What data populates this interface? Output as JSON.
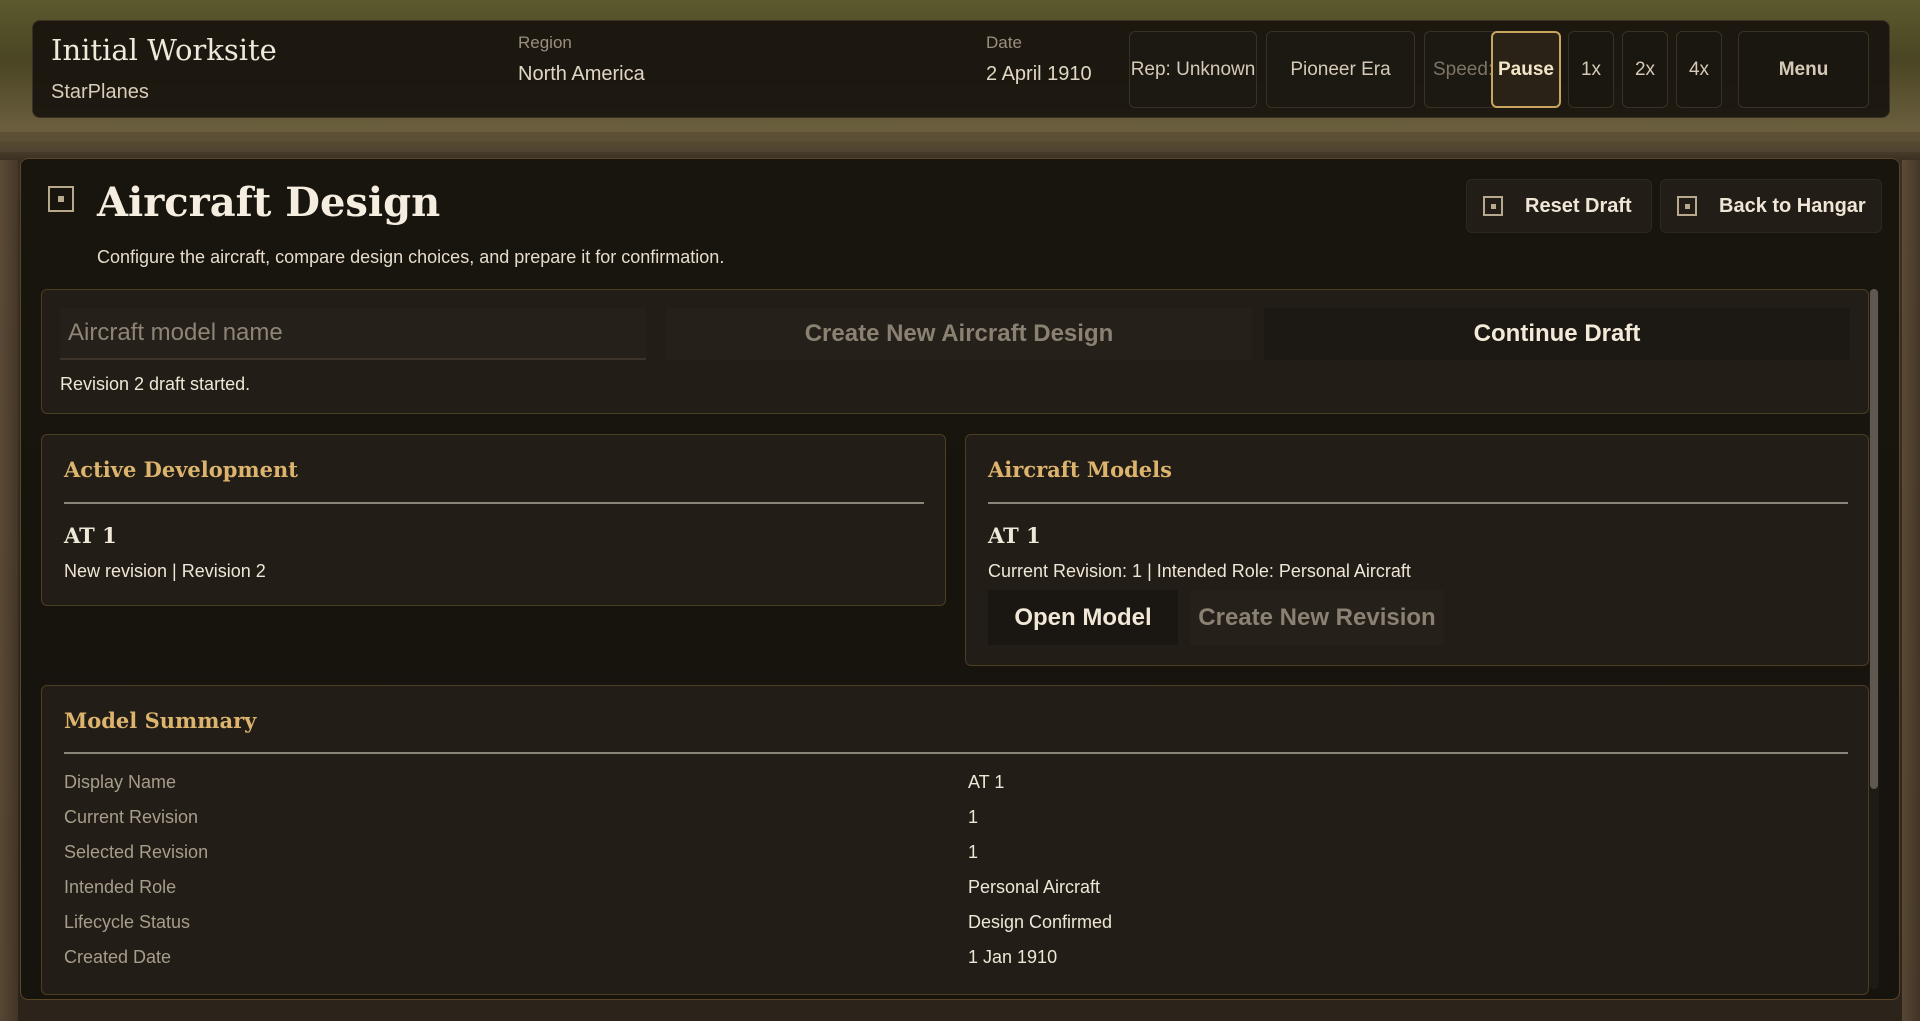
{
  "topbar": {
    "worksite": "Initial Worksite",
    "company": "StarPlanes",
    "region_label": "Region",
    "region_value": "North America",
    "date_label": "Date",
    "date_value": "2 April 1910",
    "reputation": "Rep: Unknown",
    "era": "Pioneer Era",
    "speed_label": "Speed:",
    "speeds": [
      {
        "label": "Pause",
        "active": true
      },
      {
        "label": "1x",
        "active": false
      },
      {
        "label": "2x",
        "active": false
      },
      {
        "label": "4x",
        "active": false
      }
    ],
    "menu_label": "Menu"
  },
  "panel": {
    "title": "Aircraft Design",
    "description": "Configure the aircraft, compare design choices, and prepare it for confirmation.",
    "reset_label": "Reset Draft",
    "back_label": "Back to Hangar"
  },
  "draft": {
    "name_placeholder": "Aircraft model name",
    "name_value": "",
    "create_label": "Create New Aircraft Design",
    "continue_label": "Continue Draft",
    "status": "Revision 2 draft started."
  },
  "active_development": {
    "title": "Active Development",
    "item_name": "AT 1",
    "item_detail": "New revision | Revision 2"
  },
  "aircraft_models": {
    "title": "Aircraft Models",
    "item_name": "AT 1",
    "item_detail": "Current Revision: 1 | Intended Role: Personal Aircraft",
    "open_label": "Open Model",
    "new_revision_label": "Create New Revision"
  },
  "model_summary": {
    "title": "Model Summary",
    "rows": [
      {
        "label": "Display Name",
        "value": "AT 1"
      },
      {
        "label": "Current Revision",
        "value": "1"
      },
      {
        "label": "Selected Revision",
        "value": "1"
      },
      {
        "label": "Intended Role",
        "value": "Personal Aircraft"
      },
      {
        "label": "Lifecycle Status",
        "value": "Design Confirmed"
      },
      {
        "label": "Created Date",
        "value": "1 Jan 1910"
      }
    ]
  },
  "colors": {
    "accent_gold": "#dcb46e",
    "active_speed_border": "#c9a55e"
  }
}
